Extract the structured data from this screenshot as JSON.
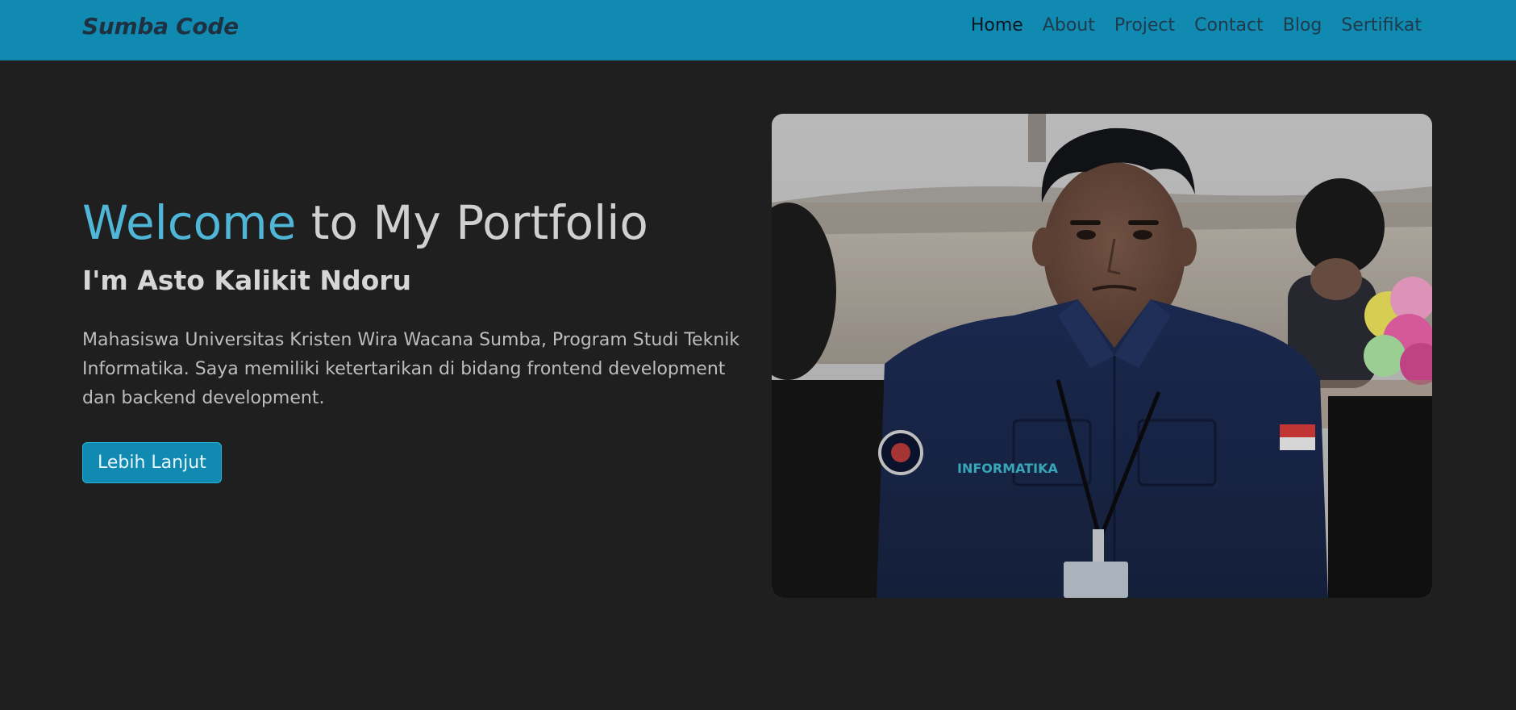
{
  "navbar": {
    "brand": "Sumba Code",
    "links": [
      {
        "label": "Home",
        "active": true
      },
      {
        "label": "About",
        "active": false
      },
      {
        "label": "Project",
        "active": false
      },
      {
        "label": "Contact",
        "active": false
      },
      {
        "label": "Blog",
        "active": false
      },
      {
        "label": "Sertifikat",
        "active": false
      }
    ]
  },
  "hero": {
    "title_accent": "Welcome",
    "title_rest": "to My Portfolio",
    "subtitle": "I'm Asto Kalikit Ndoru",
    "description": "Mahasiswa Universitas Kristen Wira Wacana Sumba, Program Studi Teknik Informatika. Saya memiliki ketertarikan di bidang frontend development dan backend development.",
    "cta_label": "Lebih Lanjut"
  },
  "photo": {
    "badge_text": "INFORMATIKA"
  },
  "colors": {
    "navbar_bg": "#118ab2",
    "page_bg": "#1f1f1f",
    "accent": "#4fb6d8"
  }
}
